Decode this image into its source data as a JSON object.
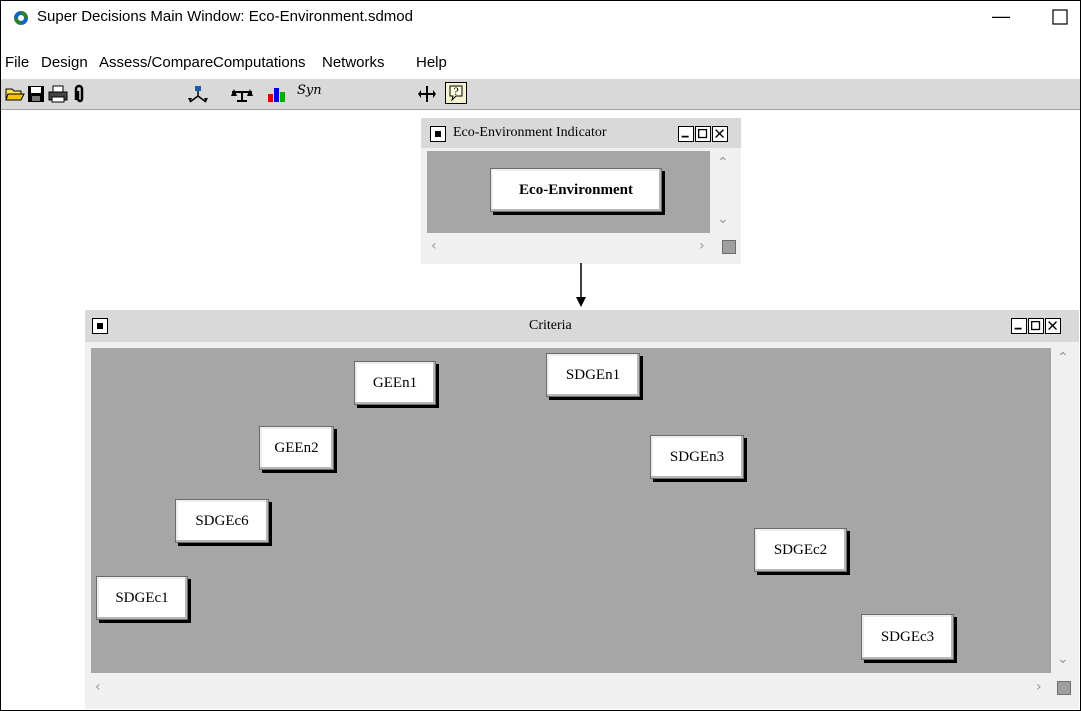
{
  "app": {
    "title": "Super Decisions Main Window: Eco-Environment.sdmod",
    "minimize_glyph": "—"
  },
  "menu": [
    "File",
    "Design",
    "Assess/Compare",
    "Computations",
    "Networks",
    "Help"
  ],
  "toolbar": {
    "icons": [
      "open-folder-icon",
      "save-icon",
      "print-icon",
      "attach-icon",
      "network-icon",
      "compare-scale-icon",
      "bar-chart-icon",
      "synthesis-icon",
      "move-icon",
      "help-icon"
    ],
    "syn_label": "Syn"
  },
  "cluster_top": {
    "title": "Eco-Environment Indicator",
    "nodes": [
      {
        "label": "Eco-Environment"
      }
    ]
  },
  "cluster_criteria": {
    "title": "Criteria",
    "nodes": [
      {
        "label": "GEEn1"
      },
      {
        "label": "SDGEn1"
      },
      {
        "label": "GEEn2"
      },
      {
        "label": "SDGEn3"
      },
      {
        "label": "SDGEc6"
      },
      {
        "label": "SDGEc2"
      },
      {
        "label": "SDGEc1"
      },
      {
        "label": "SDGEc3"
      }
    ]
  },
  "colors": {
    "canvas": "#a6a6a6",
    "toolbar": "#d9d9d9",
    "window_bg": "#f0f0f0"
  }
}
